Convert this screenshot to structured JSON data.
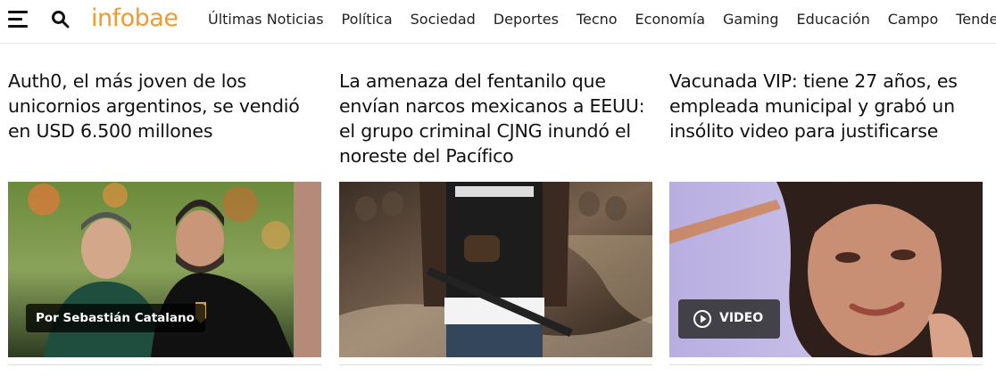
{
  "header": {
    "logo": "infobae",
    "nav": [
      "Últimas Noticias",
      "Política",
      "Sociedad",
      "Deportes",
      "Tecno",
      "Economía",
      "Gaming",
      "Educación",
      "Campo",
      "Tendencias"
    ]
  },
  "articles": [
    {
      "headline": "Auth0, el más joven de los unicornios argentinos, se vendió en USD 6.500 millones",
      "byline": "Por Sebastián Catalano"
    },
    {
      "headline": "La amenaza del fentanilo que envían narcos mexicanos a EEUU: el grupo criminal CJNG inundó el noreste del Pacífico"
    },
    {
      "headline": "Vacunada VIP: tiene 27 años, es empleada municipal y grabó un insólito video para justificarse",
      "video_label": "VIDEO"
    }
  ],
  "colors": {
    "brand": "#f29a2e"
  }
}
